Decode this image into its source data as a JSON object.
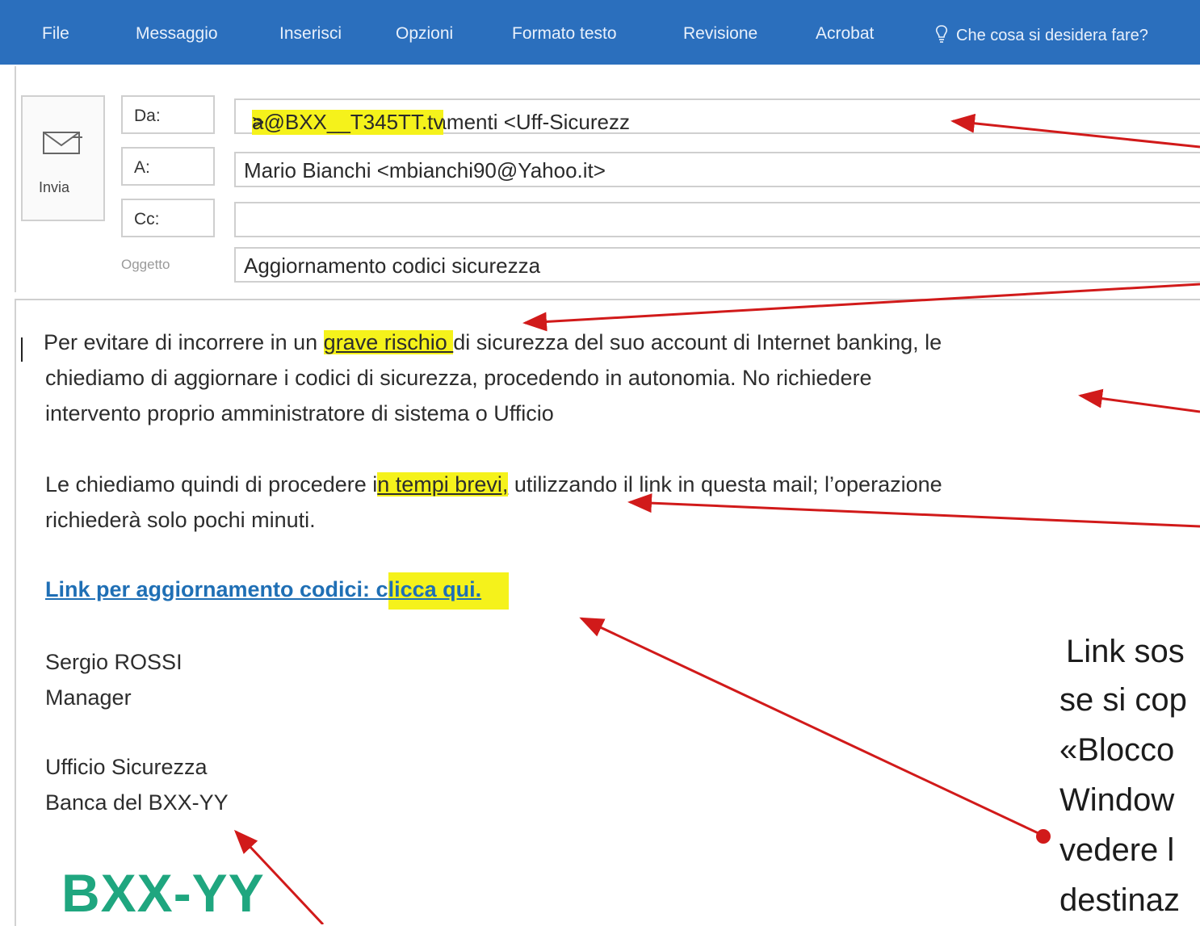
{
  "ribbon": {
    "tabs": [
      "File",
      "Messaggio",
      "Inserisci",
      "Opzioni",
      "Formato testo",
      "Revisione",
      "Acrobat"
    ],
    "tell_me": "Che cosa si desidera fare?",
    "icon": "lightbulb-icon",
    "color": "#2b6fbd"
  },
  "send": {
    "label": "Invia",
    "icon": "send-envelope-icon"
  },
  "fields": {
    "from_label": "Da:",
    "from_pre": "Banca BXX-YY pagamenti <Uff-Sicurezz",
    "from_hl": "a@BXX__T345TT.tv",
    "from_post": " >",
    "to_label": "A:",
    "to_value": "Mario Bianchi <mbianchi90@Yahoo.it>",
    "cc_label": "Cc:",
    "cc_value": "",
    "subject_label": "Oggetto",
    "subject_value": "Aggiornamento codici sicurezza"
  },
  "body": {
    "p1_a": "Per evitare di incorrere in un ",
    "p1_hl": "grave rischio ",
    "p1_b": "di sicurezza del suo account di Internet banking, le",
    "p1_line2": "chiediamo di aggiornare i codici di sicurezza, procedendo in autonomia. No richiedere",
    "p1_line3": "intervento proprio amministratore di sistema o Ufficio",
    "p2_a": "Le chiediamo quindi di procedere i",
    "p2_hl": "n tempi brevi,",
    "p2_b": " utilizzando il link in questa mail; l’operazione",
    "p2_line2": "richiederà solo pochi minuti.",
    "link_a": "Link per aggiornamento codici: c",
    "link_hl": "licca qui.",
    "sig_name": "Sergio ROSSI",
    "sig_role": "Manager",
    "sig_office": "Ufficio Sicurezza",
    "sig_bank": "Banca del BXX-YY",
    "logo": "BXX-YY"
  },
  "annotation": {
    "lines": [
      "Link sos",
      "se si cop",
      "«Blocco",
      "Window",
      "vedere l",
      "destinaz"
    ],
    "arrow_color": "#d11a1a",
    "highlight_color": "#f5f21b"
  }
}
